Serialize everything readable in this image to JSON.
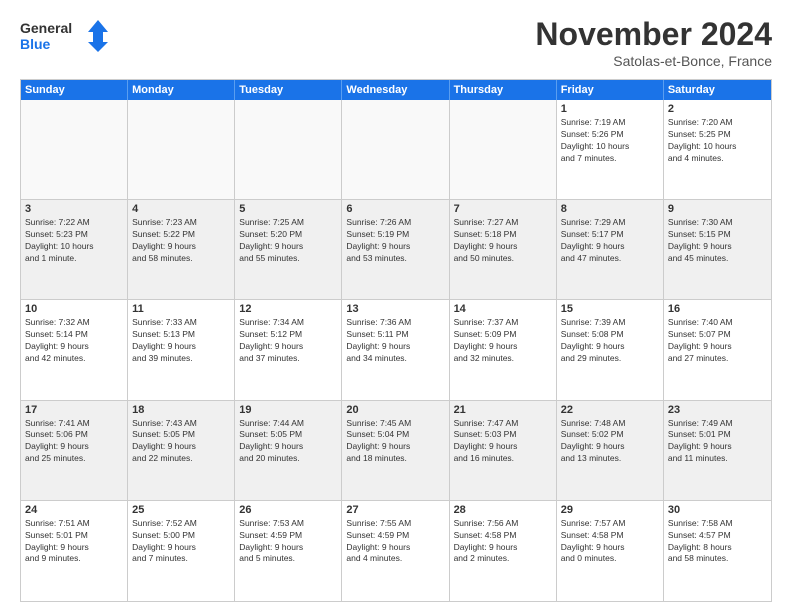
{
  "logo": {
    "line1": "General",
    "line2": "Blue"
  },
  "title": "November 2024",
  "location": "Satolas-et-Bonce, France",
  "header_days": [
    "Sunday",
    "Monday",
    "Tuesday",
    "Wednesday",
    "Thursday",
    "Friday",
    "Saturday"
  ],
  "weeks": [
    [
      {
        "day": "",
        "info": ""
      },
      {
        "day": "",
        "info": ""
      },
      {
        "day": "",
        "info": ""
      },
      {
        "day": "",
        "info": ""
      },
      {
        "day": "",
        "info": ""
      },
      {
        "day": "1",
        "info": "Sunrise: 7:19 AM\nSunset: 5:26 PM\nDaylight: 10 hours\nand 7 minutes."
      },
      {
        "day": "2",
        "info": "Sunrise: 7:20 AM\nSunset: 5:25 PM\nDaylight: 10 hours\nand 4 minutes."
      }
    ],
    [
      {
        "day": "3",
        "info": "Sunrise: 7:22 AM\nSunset: 5:23 PM\nDaylight: 10 hours\nand 1 minute."
      },
      {
        "day": "4",
        "info": "Sunrise: 7:23 AM\nSunset: 5:22 PM\nDaylight: 9 hours\nand 58 minutes."
      },
      {
        "day": "5",
        "info": "Sunrise: 7:25 AM\nSunset: 5:20 PM\nDaylight: 9 hours\nand 55 minutes."
      },
      {
        "day": "6",
        "info": "Sunrise: 7:26 AM\nSunset: 5:19 PM\nDaylight: 9 hours\nand 53 minutes."
      },
      {
        "day": "7",
        "info": "Sunrise: 7:27 AM\nSunset: 5:18 PM\nDaylight: 9 hours\nand 50 minutes."
      },
      {
        "day": "8",
        "info": "Sunrise: 7:29 AM\nSunset: 5:17 PM\nDaylight: 9 hours\nand 47 minutes."
      },
      {
        "day": "9",
        "info": "Sunrise: 7:30 AM\nSunset: 5:15 PM\nDaylight: 9 hours\nand 45 minutes."
      }
    ],
    [
      {
        "day": "10",
        "info": "Sunrise: 7:32 AM\nSunset: 5:14 PM\nDaylight: 9 hours\nand 42 minutes."
      },
      {
        "day": "11",
        "info": "Sunrise: 7:33 AM\nSunset: 5:13 PM\nDaylight: 9 hours\nand 39 minutes."
      },
      {
        "day": "12",
        "info": "Sunrise: 7:34 AM\nSunset: 5:12 PM\nDaylight: 9 hours\nand 37 minutes."
      },
      {
        "day": "13",
        "info": "Sunrise: 7:36 AM\nSunset: 5:11 PM\nDaylight: 9 hours\nand 34 minutes."
      },
      {
        "day": "14",
        "info": "Sunrise: 7:37 AM\nSunset: 5:09 PM\nDaylight: 9 hours\nand 32 minutes."
      },
      {
        "day": "15",
        "info": "Sunrise: 7:39 AM\nSunset: 5:08 PM\nDaylight: 9 hours\nand 29 minutes."
      },
      {
        "day": "16",
        "info": "Sunrise: 7:40 AM\nSunset: 5:07 PM\nDaylight: 9 hours\nand 27 minutes."
      }
    ],
    [
      {
        "day": "17",
        "info": "Sunrise: 7:41 AM\nSunset: 5:06 PM\nDaylight: 9 hours\nand 25 minutes."
      },
      {
        "day": "18",
        "info": "Sunrise: 7:43 AM\nSunset: 5:05 PM\nDaylight: 9 hours\nand 22 minutes."
      },
      {
        "day": "19",
        "info": "Sunrise: 7:44 AM\nSunset: 5:05 PM\nDaylight: 9 hours\nand 20 minutes."
      },
      {
        "day": "20",
        "info": "Sunrise: 7:45 AM\nSunset: 5:04 PM\nDaylight: 9 hours\nand 18 minutes."
      },
      {
        "day": "21",
        "info": "Sunrise: 7:47 AM\nSunset: 5:03 PM\nDaylight: 9 hours\nand 16 minutes."
      },
      {
        "day": "22",
        "info": "Sunrise: 7:48 AM\nSunset: 5:02 PM\nDaylight: 9 hours\nand 13 minutes."
      },
      {
        "day": "23",
        "info": "Sunrise: 7:49 AM\nSunset: 5:01 PM\nDaylight: 9 hours\nand 11 minutes."
      }
    ],
    [
      {
        "day": "24",
        "info": "Sunrise: 7:51 AM\nSunset: 5:01 PM\nDaylight: 9 hours\nand 9 minutes."
      },
      {
        "day": "25",
        "info": "Sunrise: 7:52 AM\nSunset: 5:00 PM\nDaylight: 9 hours\nand 7 minutes."
      },
      {
        "day": "26",
        "info": "Sunrise: 7:53 AM\nSunset: 4:59 PM\nDaylight: 9 hours\nand 5 minutes."
      },
      {
        "day": "27",
        "info": "Sunrise: 7:55 AM\nSunset: 4:59 PM\nDaylight: 9 hours\nand 4 minutes."
      },
      {
        "day": "28",
        "info": "Sunrise: 7:56 AM\nSunset: 4:58 PM\nDaylight: 9 hours\nand 2 minutes."
      },
      {
        "day": "29",
        "info": "Sunrise: 7:57 AM\nSunset: 4:58 PM\nDaylight: 9 hours\nand 0 minutes."
      },
      {
        "day": "30",
        "info": "Sunrise: 7:58 AM\nSunset: 4:57 PM\nDaylight: 8 hours\nand 58 minutes."
      }
    ]
  ]
}
